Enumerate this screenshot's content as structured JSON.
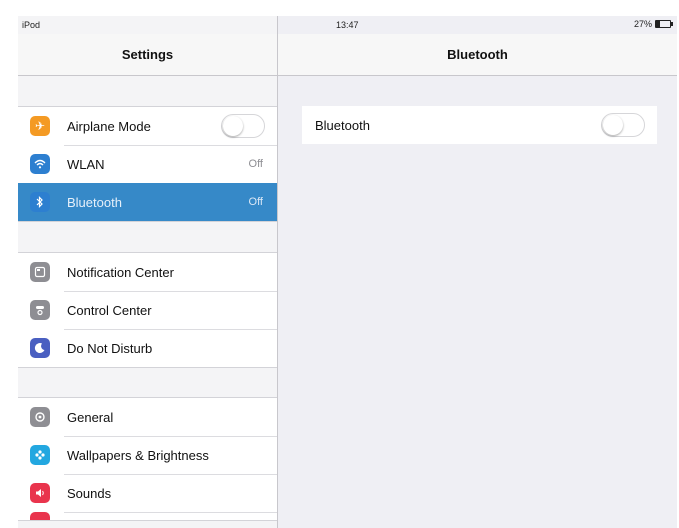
{
  "status_bar": {
    "device": "iPod",
    "time": "13:47",
    "battery": "27%"
  },
  "master": {
    "title": "Settings",
    "groups": [
      [
        {
          "label": "Airplane Mode",
          "icon": "airplane-icon",
          "color": "#f49a24",
          "toggle": false
        },
        {
          "label": "WLAN",
          "value": "Off",
          "icon": "wifi-icon",
          "color": "#2d7fd0"
        },
        {
          "label": "Bluetooth",
          "value": "Off",
          "icon": "bluetooth-icon",
          "color": "#2d7fd0",
          "selected": true
        }
      ],
      [
        {
          "label": "Notification Center",
          "icon": "notification-center-icon",
          "color": "#8e8e93"
        },
        {
          "label": "Control Center",
          "icon": "control-center-icon",
          "color": "#8e8e93"
        },
        {
          "label": "Do Not Disturb",
          "icon": "moon-icon",
          "color": "#4a5fc1"
        }
      ],
      [
        {
          "label": "General",
          "icon": "gear-icon",
          "color": "#8e8e93"
        },
        {
          "label": "Wallpapers & Brightness",
          "icon": "flower-icon",
          "color": "#23a7e0"
        },
        {
          "label": "Sounds",
          "icon": "speaker-icon",
          "color": "#e9344d"
        }
      ]
    ]
  },
  "detail": {
    "title": "Bluetooth",
    "bluetooth_label": "Bluetooth",
    "bluetooth_on": false
  },
  "colors": {
    "selection": "#3689c8",
    "background": "#efeff4"
  }
}
